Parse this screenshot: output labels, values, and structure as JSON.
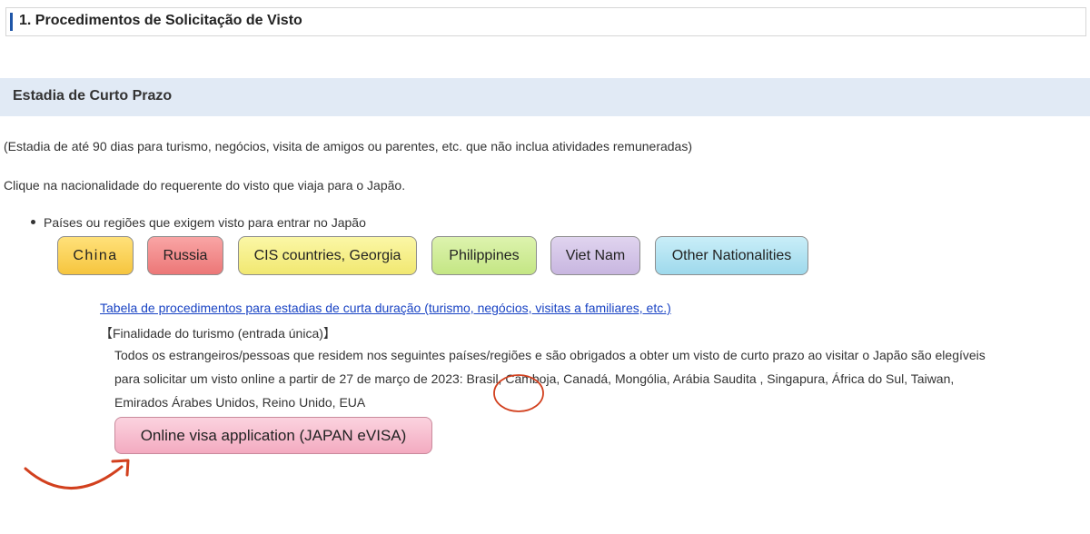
{
  "section_header": {
    "title": "1. Procedimentos de Solicitação de Visto"
  },
  "sub_header": {
    "title": "Estadia de Curto Prazo"
  },
  "intro": {
    "line1": "(Estadia de até 90 dias para turismo, negócios, visita de amigos ou parentes, etc. que não inclua atividades remuneradas)",
    "line2": "Clique na nacionalidade do requerente do visto que viaja para o Japão."
  },
  "bullet": {
    "text": "Países ou regiões que exigem visto para entrar no Japão"
  },
  "nationality_buttons": {
    "china": "China",
    "russia": "Russia",
    "cis": "CIS countries, Georgia",
    "philippines": "Philippines",
    "vietnam": "Viet Nam",
    "other": "Other Nationalities"
  },
  "procedures_link": "Tabela de procedimentos para estadias de curta duração (turismo, negócios, visitas a familiares, etc.)",
  "tourism_title": "【Finalidade do turismo (entrada única)】",
  "tourism_body": {
    "line1": "Todos os estrangeiros/pessoas que residem nos seguintes países/regiões e são obrigados a obter um visto de curto prazo ao visitar o Japão são elegíveis",
    "line2": "para solicitar um visto online a partir de 27 de março de 2023: Brasil, Camboja, Canadá, Mongólia, Arábia Saudita , Singapura, África do Sul, Taiwan,",
    "line3": "Emirados Árabes Unidos, Reino Unido, EUA"
  },
  "evisa_button": "Online visa application (JAPAN eVISA)",
  "annotation_color": "#d2401e"
}
